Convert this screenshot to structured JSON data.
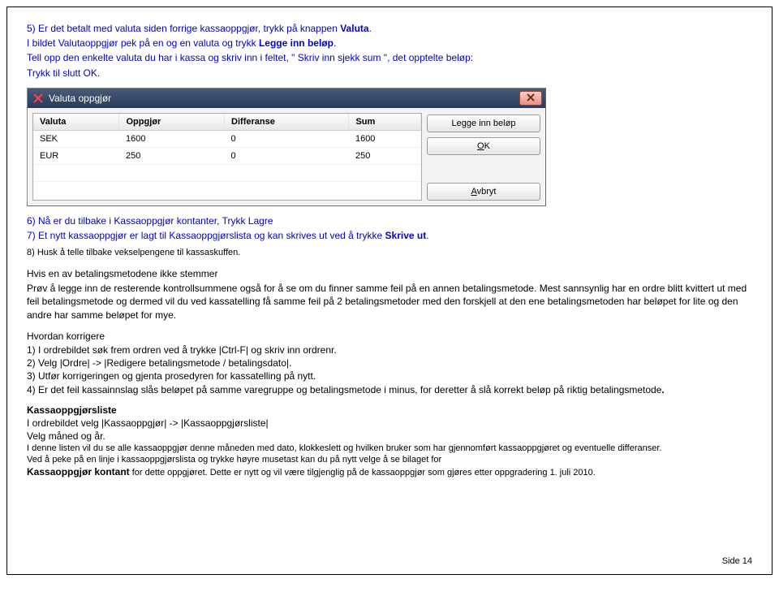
{
  "text": {
    "p5a_pre": "5) Er det betalt med valuta siden forrige kassaoppgjør, trykk på knappen ",
    "p5a_bold": "Valuta",
    "p5a_post": ".",
    "p5b_pre": "I bildet Valutaoppgjør pek på en og en valuta og trykk ",
    "p5b_bold": "Legge inn beløp",
    "p5b_post": ".",
    "p5c": "Tell opp den enkelte valuta du har i kassa og skriv inn i feltet, \" Skriv inn sjekk sum \", det opptelte beløp:",
    "p5d": "Trykk til slutt OK.",
    "p6": "6) Nå er du tilbake i Kassaoppgjør kontanter, Trykk Lagre",
    "p7_pre": "7) Et nytt kassaoppgjør er lagt til Kassaoppgjørslista og kan skrives ut ved å trykke ",
    "p7_bold": "Skrive ut",
    "p7_post": ".",
    "p8": "8) Husk å telle tilbake vekselpengene til kassaskuffen.",
    "h_err": "Hvis en av betalingsmetodene ikke stemmer",
    "err_body": "Prøv å legge inn de resterende kontrollsummene også for å se om du finner samme feil på en annen betalingsmetode. Mest sannsynlig har en ordre blitt kvittert ut med feil betalingsmetode og dermed vil du ved kassatelling få samme feil på 2 betalingsmetoder med den forskjell at den ene betalingsmetoden har beløpet for lite og den andre har samme beløpet for mye.",
    "h_fix": "Hvordan korrigere",
    "fix1": "1) I ordrebildet søk frem ordren ved å trykke |Ctrl-F| og skriv inn ordrenr.",
    "fix2": "2) Velg |Ordre| -> |Redigere betalingsmetode / betalingsdato|.",
    "fix3": "3) Utfør korrigeringen og gjenta prosedyren for kassatelling på nytt.",
    "fix4_pre": "4) Er det feil kassainnslag slås beløpet på samme varegruppe og betalingsmetode i minus, for deretter å slå korrekt beløp på riktig betalingsmetode",
    "fix4_post": ".",
    "h_list": "Kassaoppgjørsliste",
    "list1": "I ordrebildet velg |Kassaoppgjør| -> |Kassaoppgjørsliste|",
    "list2": "Velg måned og år.",
    "list3": "I denne listen vil du se alle kassaoppgjør denne måneden med dato, klokkeslett og hvilken bruker som har gjennomført kassaoppgjøret og eventuelle differanser.",
    "list4": "Ved å peke på en linje i kassaoppgjørslista og trykke høyre musetast kan du på nytt velge å se bilaget for",
    "list5_bold": "Kassaoppgjør kontant",
    "list5_rest": " for dette oppgjøret. Dette er nytt og vil være tilgjenglig på de kassaoppgjør som gjøres etter oppgradering 1. juli 2010.",
    "page_num": "Side 14"
  },
  "dialog": {
    "title": "Valuta oppgjør",
    "headers": {
      "c1": "Valuta",
      "c2": "Oppgjør",
      "c3": "Differanse",
      "c4": "Sum"
    },
    "rows": [
      {
        "c1": "SEK",
        "c2": "1600",
        "c3": "0",
        "c4": "1600"
      },
      {
        "c1": "EUR",
        "c2": "250",
        "c3": "0",
        "c4": "250"
      }
    ],
    "btn_legge": "Legge inn beløp",
    "btn_ok_u": "O",
    "btn_ok_rest": "K",
    "btn_avbryt_u": "A",
    "btn_avbryt_rest": "vbryt"
  }
}
